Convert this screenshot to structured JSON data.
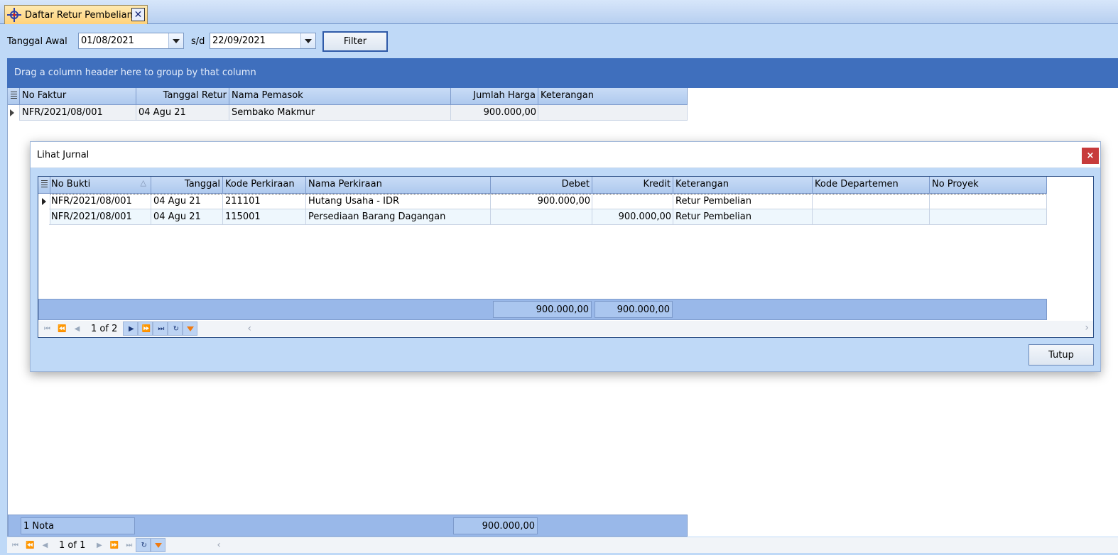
{
  "tab": {
    "title": "Daftar Retur Pembelian",
    "close": "✕"
  },
  "filter": {
    "start_label": "Tanggal Awal",
    "start_value": "01/08/2021",
    "sep_label": "s/d",
    "end_value": "22/09/2021",
    "button": "Filter"
  },
  "group_panel": "Drag a column header here to group by that column",
  "main_grid": {
    "columns": [
      "No Faktur",
      "Tanggal Retur",
      "Nama Pemasok",
      "Jumlah Harga",
      "Keterangan"
    ],
    "rows": [
      [
        "NFR/2021/08/001",
        "04 Agu 21",
        "Sembako Makmur",
        "900.000,00",
        ""
      ]
    ],
    "footer_count": "1 Nota",
    "footer_total": "900.000,00",
    "pager": "1 of 1"
  },
  "dialog": {
    "title": "Lihat Jurnal",
    "close": "×",
    "columns": [
      "No Bukti",
      "Tanggal",
      "Kode Perkiraan",
      "Nama Perkiraan",
      "Debet",
      "Kredit",
      "Keterangan",
      "Kode Departemen",
      "No Proyek"
    ],
    "rows": [
      [
        "NFR/2021/08/001",
        "04 Agu 21",
        "211101",
        "Hutang Usaha - IDR",
        "900.000,00",
        "",
        "Retur Pembelian",
        "",
        ""
      ],
      [
        "NFR/2021/08/001",
        "04 Agu 21",
        "115001",
        "Persediaan Barang Dagangan",
        "",
        "900.000,00",
        "Retur Pembelian",
        "",
        ""
      ]
    ],
    "footer_debet": "900.000,00",
    "footer_kredit": "900.000,00",
    "pager": "1 of 2",
    "close_button": "Tutup"
  }
}
